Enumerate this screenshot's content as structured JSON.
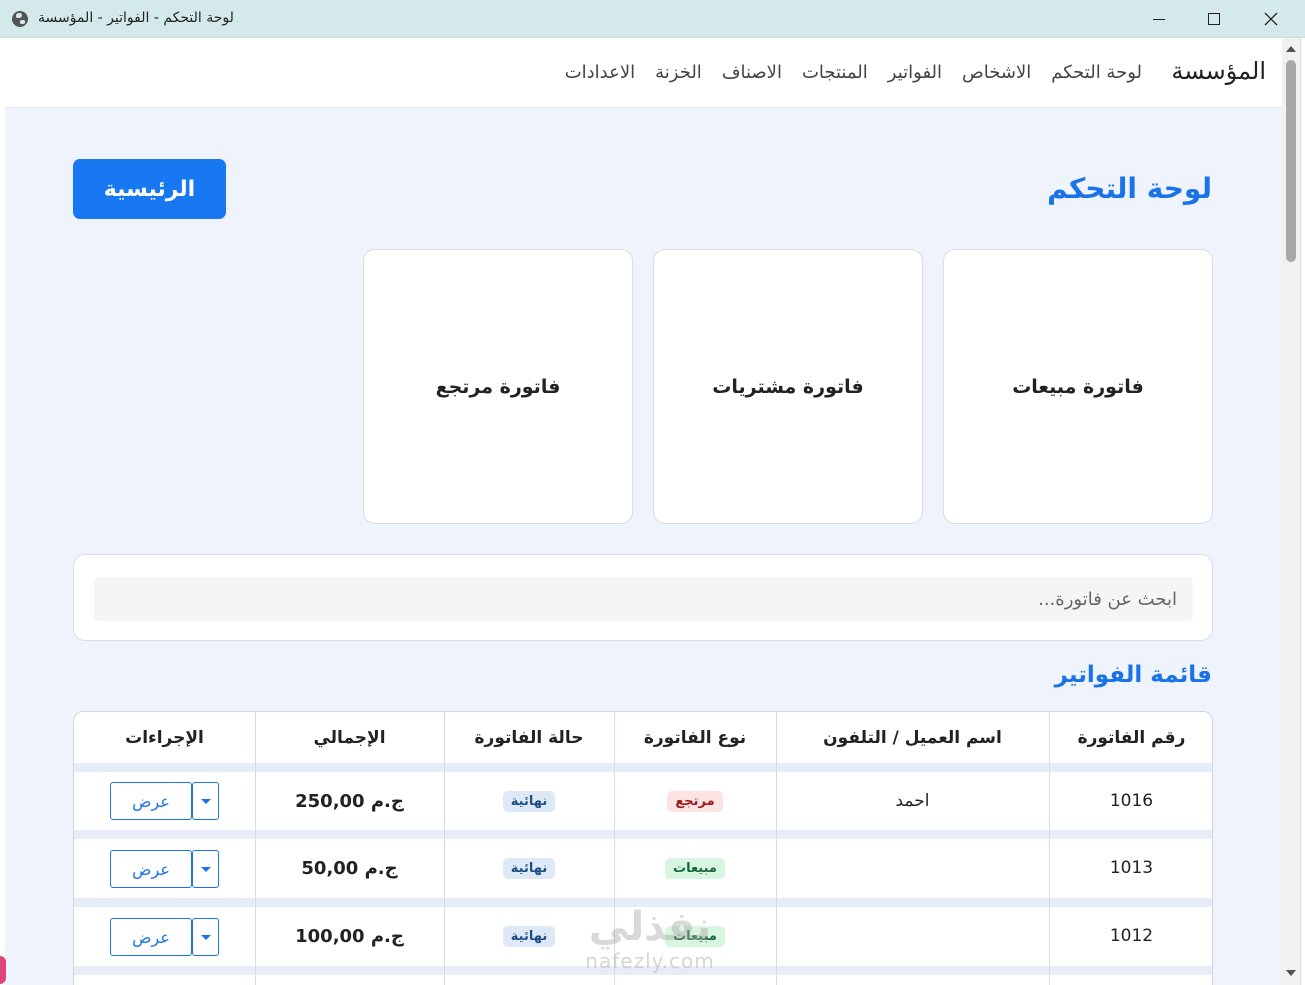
{
  "window": {
    "title": "لوحة التحكم - الفواتير - المؤسسة"
  },
  "navbar": {
    "brand": "المؤسسة",
    "items": [
      "لوحة التحكم",
      "الاشخاص",
      "الفواتير",
      "المنتجات",
      "الاصناف",
      "الخزنة",
      "الاعدادات"
    ]
  },
  "page": {
    "title": "لوحة التحكم",
    "home_button": "الرئيسية"
  },
  "cards": {
    "sales": "فاتورة مبيعات",
    "purchases": "فاتورة مشتريات",
    "returns": "فاتورة مرتجع"
  },
  "search": {
    "placeholder": "ابحث عن فاتورة..."
  },
  "invoices": {
    "title": "قائمة الفواتير",
    "columns": [
      "رقم الفاتورة",
      "اسم العميل / التلفون",
      "نوع الفاتورة",
      "حالة الفاتورة",
      "الإجمالي",
      "الإجراءات"
    ],
    "view_label": "عرض",
    "rows": [
      {
        "number": "1016",
        "customer": "احمد",
        "type": "مرتجع",
        "type_kind": "return",
        "status": "نهائية",
        "total": "250,00 ج.م"
      },
      {
        "number": "1013",
        "customer": "",
        "type": "مبيعات",
        "type_kind": "sale",
        "status": "نهائية",
        "total": "50,00 ج.م"
      },
      {
        "number": "1012",
        "customer": "",
        "type": "مبيعات",
        "type_kind": "sale",
        "status": "نهائية",
        "total": "100,00 ج.م"
      }
    ]
  },
  "watermark": {
    "logo": "نفذلي",
    "url": "nafezly.com"
  },
  "colors": {
    "primary": "#1778f2",
    "accent_text": "#1a73e8",
    "background": "#eef3fc",
    "titlebar": "#d4eaea"
  }
}
